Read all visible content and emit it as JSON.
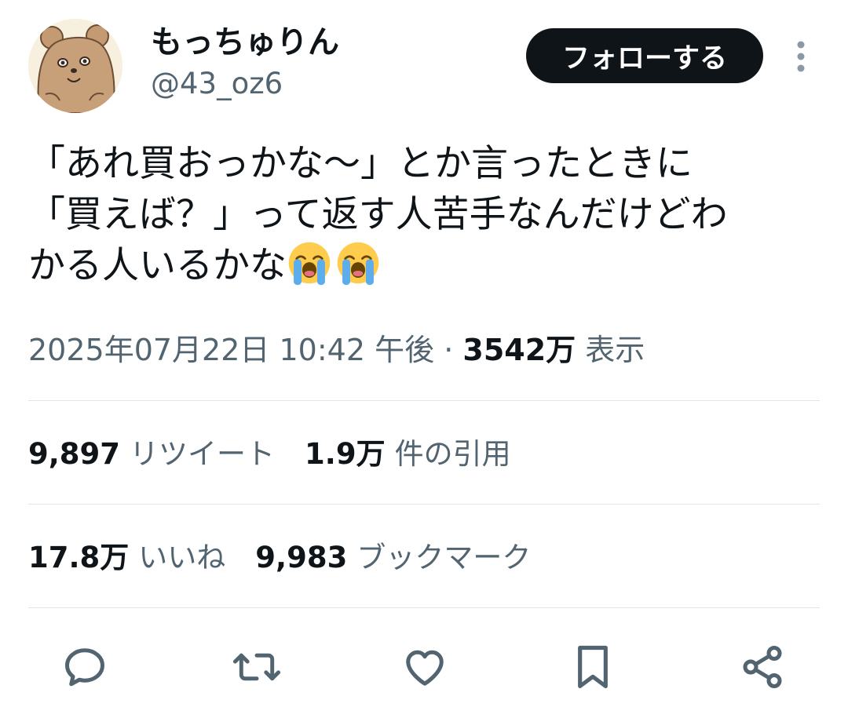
{
  "user": {
    "display_name": "もっちゅりん",
    "handle": "@43_oz6"
  },
  "header": {
    "follow_label": "フォローする",
    "more_icon": "more-vertical-icon"
  },
  "tweet": {
    "text_line1": "「あれ買おっかな〜」とか言ったときに",
    "text_line2": "「買えば？」って返す人苦手なんだけどわ",
    "text_line3": "かる人いるかな",
    "emoji": [
      "loudly-crying-face-emoji",
      "loudly-crying-face-emoji"
    ]
  },
  "meta": {
    "timestamp": "2025年07月22日 10:42 午後",
    "separator": "·",
    "views_count": "3542万",
    "views_label": "表示"
  },
  "stats": {
    "retweets_count": "9,897",
    "retweets_label": "リツイート",
    "quotes_count": "1.9万",
    "quotes_label": "件の引用",
    "likes_count": "17.8万",
    "likes_label": "いいね",
    "bookmarks_count": "9,983",
    "bookmarks_label": "ブックマーク"
  },
  "actions": [
    {
      "icon": "reply-icon"
    },
    {
      "icon": "retweet-icon"
    },
    {
      "icon": "like-icon"
    },
    {
      "icon": "bookmark-icon"
    },
    {
      "icon": "share-icon"
    }
  ],
  "colors": {
    "text": "#0f1419",
    "secondary": "#536471",
    "divider": "#e1e5e8",
    "follow_bg": "#0f1419"
  }
}
